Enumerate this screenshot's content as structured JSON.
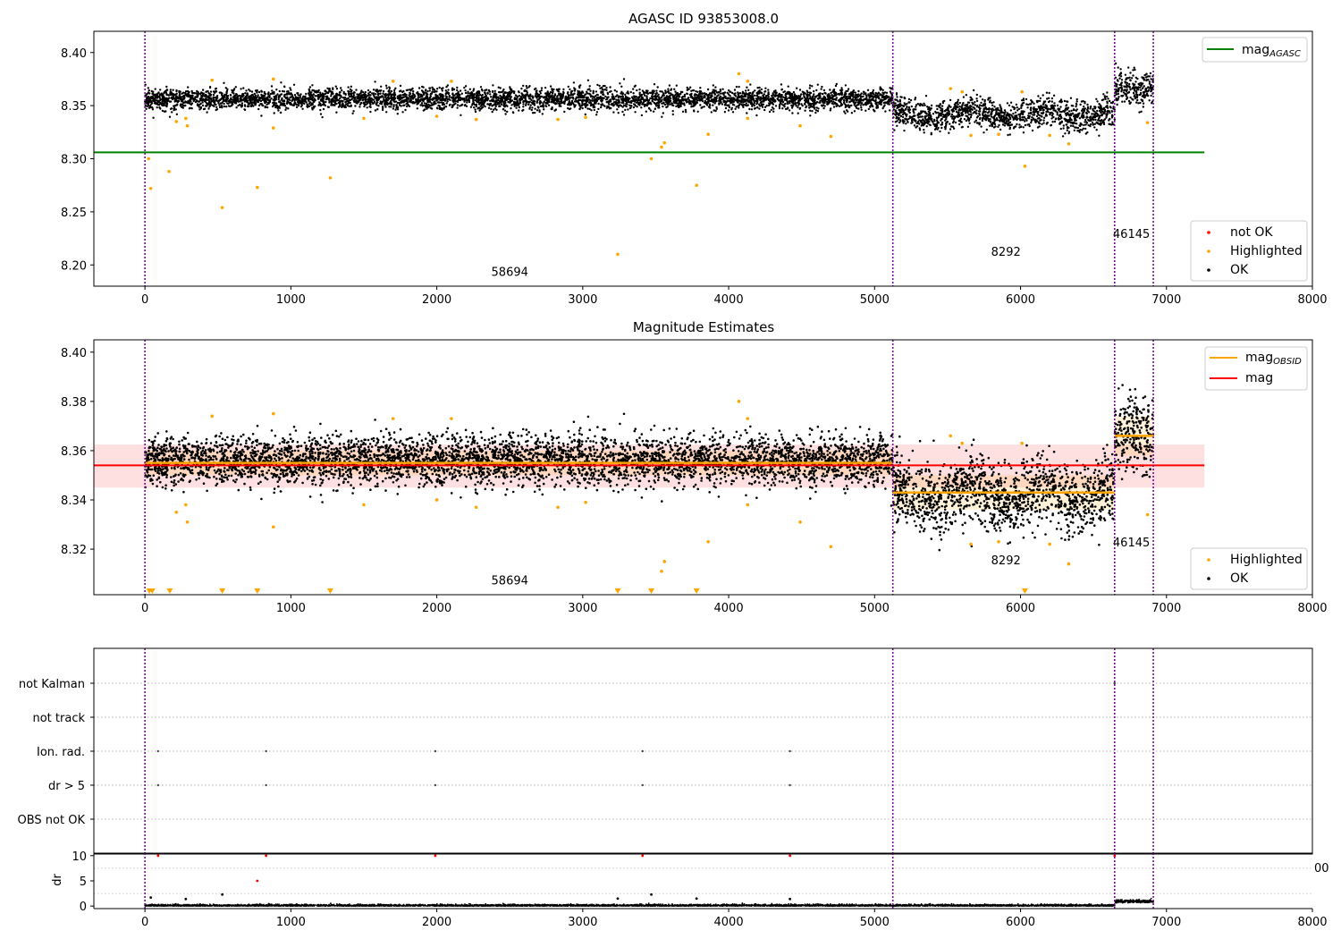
{
  "chart_data": [
    {
      "type": "scatter",
      "title": "AGASC ID 93853008.0",
      "xlim": [
        -350,
        8000
      ],
      "ylim": [
        8.18,
        8.42
      ],
      "x_ticks": [
        "0",
        "1000",
        "2000",
        "3000",
        "4000",
        "5000",
        "6000",
        "7000",
        "8000"
      ],
      "y_ticks": [
        "8.20",
        "8.25",
        "8.30",
        "8.35",
        "8.40"
      ],
      "obsid_boundaries": [
        0,
        5125,
        6645,
        6910
      ],
      "obsid_labels": [
        "58694",
        "8292",
        "46145"
      ],
      "reference_lines": [
        {
          "name": "mag_AGASC",
          "y": 8.306,
          "x_range": [
            -350,
            7260
          ],
          "color": "#008000"
        }
      ],
      "segments": [
        {
          "x": [
            0,
            5125
          ],
          "mean": 8.356,
          "spread": 0.005
        },
        {
          "x": [
            5125,
            6645
          ],
          "mean": 8.342,
          "spread": 0.007
        },
        {
          "x": [
            6645,
            6910
          ],
          "mean": 8.366,
          "spread": 0.008
        }
      ],
      "highlighted_points": [
        {
          "x": 25,
          "y": 8.3
        },
        {
          "x": 40,
          "y": 8.272
        },
        {
          "x": 165,
          "y": 8.288
        },
        {
          "x": 215,
          "y": 8.335
        },
        {
          "x": 280,
          "y": 8.338
        },
        {
          "x": 290,
          "y": 8.331
        },
        {
          "x": 530,
          "y": 8.254
        },
        {
          "x": 770,
          "y": 8.273
        },
        {
          "x": 880,
          "y": 8.329
        },
        {
          "x": 1270,
          "y": 8.282
        },
        {
          "x": 1500,
          "y": 8.338
        },
        {
          "x": 2000,
          "y": 8.34
        },
        {
          "x": 2270,
          "y": 8.337
        },
        {
          "x": 2830,
          "y": 8.337
        },
        {
          "x": 3020,
          "y": 8.339
        },
        {
          "x": 3240,
          "y": 8.21
        },
        {
          "x": 3470,
          "y": 8.3
        },
        {
          "x": 3540,
          "y": 8.311
        },
        {
          "x": 3560,
          "y": 8.315
        },
        {
          "x": 3780,
          "y": 8.275
        },
        {
          "x": 3860,
          "y": 8.323
        },
        {
          "x": 4130,
          "y": 8.338
        },
        {
          "x": 4490,
          "y": 8.331
        },
        {
          "x": 4700,
          "y": 8.321
        },
        {
          "x": 4070,
          "y": 8.38
        },
        {
          "x": 4130,
          "y": 8.373
        },
        {
          "x": 460,
          "y": 8.374
        },
        {
          "x": 880,
          "y": 8.375
        },
        {
          "x": 1700,
          "y": 8.373
        },
        {
          "x": 2100,
          "y": 8.373
        },
        {
          "x": 5660,
          "y": 8.322
        },
        {
          "x": 5850,
          "y": 8.323
        },
        {
          "x": 6030,
          "y": 8.293
        },
        {
          "x": 6330,
          "y": 8.314
        },
        {
          "x": 6200,
          "y": 8.322
        },
        {
          "x": 6870,
          "y": 8.334
        },
        {
          "x": 5520,
          "y": 8.366
        },
        {
          "x": 5600,
          "y": 8.363
        },
        {
          "x": 6010,
          "y": 8.363
        }
      ],
      "legend": [
        {
          "group": "lines",
          "entries": [
            {
              "label": "mag",
              "sub": "AGASC",
              "color": "#008000"
            }
          ]
        },
        {
          "group": "markers",
          "entries": [
            {
              "label": "not OK",
              "color": "#ff0000"
            },
            {
              "label": "Highlighted",
              "color": "#ffa500"
            },
            {
              "label": "OK",
              "color": "#000000"
            }
          ]
        }
      ]
    },
    {
      "type": "scatter",
      "title": "Magnitude Estimates",
      "xlim": [
        -350,
        8000
      ],
      "ylim": [
        8.3015,
        8.405
      ],
      "x_ticks": [
        "0",
        "1000",
        "2000",
        "3000",
        "4000",
        "5000",
        "6000",
        "7000",
        "8000"
      ],
      "y_ticks": [
        "8.32",
        "8.34",
        "8.36",
        "8.38",
        "8.40"
      ],
      "obsid_boundaries": [
        0,
        5125,
        6645,
        6910
      ],
      "obsid_labels": [
        "58694",
        "8292",
        "46145"
      ],
      "mag_line": {
        "name": "mag",
        "y": 8.354,
        "band": [
          8.345,
          8.3625
        ],
        "x_range": [
          -350,
          7260
        ],
        "color": "#ff0000"
      },
      "obsid_mags": [
        {
          "x": [
            0,
            5125
          ],
          "y": 8.355,
          "band": [
            8.35,
            8.36
          ]
        },
        {
          "x": [
            5125,
            6645
          ],
          "y": 8.343,
          "band": [
            8.336,
            8.35
          ]
        },
        {
          "x": [
            6645,
            6910
          ],
          "y": 8.366,
          "band": [
            8.358,
            8.374
          ]
        }
      ],
      "below_range_markers_x": [
        30,
        50,
        170,
        530,
        770,
        1270,
        3240,
        3470,
        3780,
        6030
      ],
      "legend": [
        {
          "group": "lines",
          "entries": [
            {
              "label": "mag",
              "sub": "OBSID",
              "color": "#ffa500"
            },
            {
              "label": "mag",
              "sub": "",
              "color": "#ff0000"
            }
          ]
        },
        {
          "group": "markers",
          "entries": [
            {
              "label": "Highlighted",
              "color": "#ffa500"
            },
            {
              "label": "OK",
              "color": "#000000"
            }
          ]
        }
      ]
    },
    {
      "type": "scatter",
      "title": "",
      "xlim": [
        -350,
        8000
      ],
      "categories": [
        "not Kalman",
        "not track",
        "Ion. rad.",
        "dr > 5",
        "OBS not OK"
      ],
      "flags": {
        "not Kalman": [
          6645
        ],
        "not track": [],
        "Ion. rad.": [
          90,
          830,
          1990,
          3410,
          4420
        ],
        "dr > 5": [
          90,
          830,
          1990,
          3410,
          4420
        ],
        "OBS not OK": []
      },
      "obsid_boundaries": [
        0,
        5125,
        6645,
        6910
      ]
    },
    {
      "type": "scatter",
      "title": "",
      "xlim": [
        -350,
        8000
      ],
      "ylim": [
        -0.5,
        10.5
      ],
      "ylabel": "dr",
      "x_ticks": [
        "0",
        "1000",
        "2000",
        "3000",
        "4000",
        "5000",
        "6000",
        "7000",
        "8000"
      ],
      "y_ticks": [
        "0",
        "5",
        "10"
      ],
      "edge_label": "00",
      "outliers": [
        {
          "x": 90,
          "y": 10,
          "color": "#ff0000"
        },
        {
          "x": 830,
          "y": 10,
          "color": "#ff0000"
        },
        {
          "x": 1990,
          "y": 10,
          "color": "#ff0000"
        },
        {
          "x": 3410,
          "y": 10,
          "color": "#ff0000"
        },
        {
          "x": 4420,
          "y": 10,
          "color": "#ff0000"
        },
        {
          "x": 6645,
          "y": 10,
          "color": "#ff0000"
        },
        {
          "x": 770,
          "y": 5,
          "color": "#ff0000"
        },
        {
          "x": 530,
          "y": 2.3,
          "color": "#000000"
        },
        {
          "x": 3240,
          "y": 1.5,
          "color": "#000000"
        },
        {
          "x": 3470,
          "y": 2.3,
          "color": "#000000"
        },
        {
          "x": 3780,
          "y": 1.5,
          "color": "#000000"
        },
        {
          "x": 4420,
          "y": 1.4,
          "color": "#000000"
        },
        {
          "x": 280,
          "y": 1.4,
          "color": "#000000"
        },
        {
          "x": 40,
          "y": 1.7,
          "color": "#000000"
        }
      ],
      "obsid_boundaries": [
        0,
        5125,
        6645,
        6910
      ]
    }
  ]
}
